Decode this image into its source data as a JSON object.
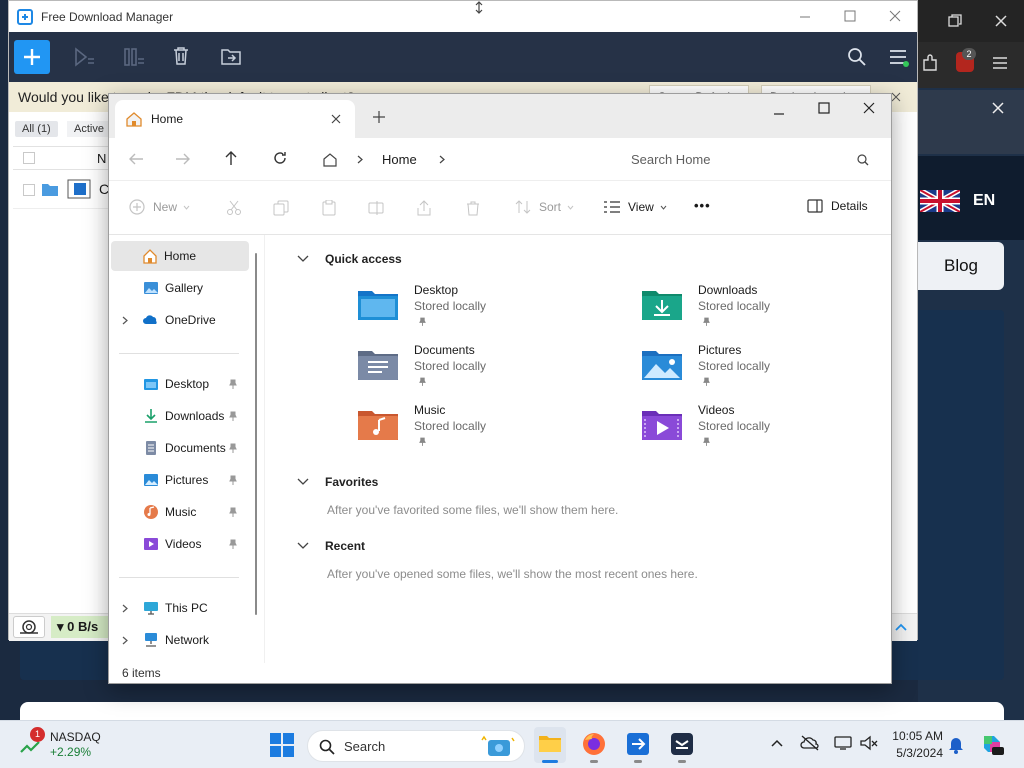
{
  "browser": {
    "language": "EN",
    "nav_button": "Blog",
    "notification_count": "2"
  },
  "fdm": {
    "title": "Free Download Manager",
    "banner_text": "Would you like to make FDM the default torrent client?",
    "banner_btn_1": "Set as Default",
    "banner_btn_2": "Don't ask again",
    "tabs": [
      "All (1)",
      "Active"
    ],
    "column_name": "N",
    "row_name": "C",
    "speed": "▾ 0 B/s"
  },
  "explorer": {
    "tab_title": "Home",
    "breadcrumb": "Home",
    "search_placeholder": "Search Home",
    "commands": {
      "new": "New",
      "sort": "Sort",
      "view": "View",
      "more": "•••",
      "details": "Details"
    },
    "nav": {
      "top": [
        {
          "label": "Home",
          "icon": "home-icon",
          "selected": true
        },
        {
          "label": "Gallery",
          "icon": "gallery-icon"
        },
        {
          "label": "OneDrive",
          "icon": "onedrive-icon",
          "expandable": true
        }
      ],
      "pinned": [
        {
          "label": "Desktop",
          "icon": "desktop-folder-icon"
        },
        {
          "label": "Downloads",
          "icon": "downloads-folder-icon"
        },
        {
          "label": "Documents",
          "icon": "documents-folder-icon"
        },
        {
          "label": "Pictures",
          "icon": "pictures-folder-icon"
        },
        {
          "label": "Music",
          "icon": "music-folder-icon"
        },
        {
          "label": "Videos",
          "icon": "videos-folder-icon"
        }
      ],
      "bottom": [
        {
          "label": "This PC",
          "icon": "this-pc-icon",
          "expandable": true
        },
        {
          "label": "Network",
          "icon": "network-icon",
          "expandable": true
        }
      ]
    },
    "sections": {
      "quick_access": "Quick access",
      "favorites": "Favorites",
      "favorites_empty": "After you've favorited some files, we'll show them here.",
      "recent": "Recent",
      "recent_empty": "After you've opened some files, we'll show the most recent ones here."
    },
    "quick_access_items": [
      {
        "name": "Desktop",
        "location": "Stored locally",
        "color": "#1e8fd6"
      },
      {
        "name": "Downloads",
        "location": "Stored locally",
        "color": "#1aa68a"
      },
      {
        "name": "Documents",
        "location": "Stored locally",
        "color": "#7b8aa6"
      },
      {
        "name": "Pictures",
        "location": "Stored locally",
        "color": "#2a8bd8"
      },
      {
        "name": "Music",
        "location": "Stored locally",
        "color": "#e57a4a"
      },
      {
        "name": "Videos",
        "location": "Stored locally",
        "color": "#8a4ad8"
      }
    ],
    "status": "6 items"
  },
  "taskbar": {
    "stock_name": "NASDAQ",
    "stock_change": "+2.29%",
    "stock_badge": "1",
    "search_label": "Search",
    "time": "10:05 AM",
    "date": "5/3/2024"
  },
  "colors": {
    "fdm_toolbar": "#263247",
    "fdm_accent": "#2196f3",
    "explorer_selected": "#e6e6e6",
    "taskbar": "#e9eef5"
  }
}
